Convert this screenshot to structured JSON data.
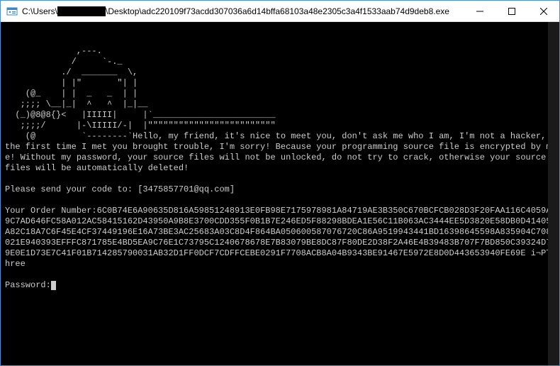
{
  "window": {
    "title_prefix": "C:\\Users\\",
    "title_redacted": "████████",
    "title_suffix": "\\Desktop\\adc220109f73acdd307036a6d14bffa68103a48e2305c3a4f1533aab74d9deb8.exe"
  },
  "console": {
    "ascii_art": "              ,---.\n             /     `-._\n           ./  _______  \\,\n           | |\"       \"| |\n    (@_    | |  _   _  | |\n   ;;;; \\__|_|  ^   ^  |_|__\n  (_)@8@8{}<   |IIIII|     |`________________________\n   ;;;;/      |-\\IIIII/-|  |\"\"\"\"\"\"\"\"\"\"\"\"\"\"\"\"\"\"\"\"\"\"\"\"\"\n    (@         `--------`",
    "greeting": "Hello, my friend, it's nice to meet you, don't ask me who I am, I'm not a hacker, the first time I met you brought trouble, I'm sorry! Because your programming source file is encrypted by me! Without my password, your source files will not be unlocked, do not try to crack, otherwise your source files will be automatically deleted!",
    "send_code_label": "Please send your code to: ",
    "send_code_email": "[3475857701@qq.com]",
    "order_label": "Your Order Number:",
    "order_number": "6C0B74E6A90635D816A59851248913E0FB98E7175978981A84719AE3B350C670BCFCB028D3F20FAA116C4059A9C7AD646FC58A012AC58415162D43950A9B8E3700CDD355F0B1B7E246ED5F88298BDEA1E56C11B063AC3444EE5D3820E58DB0D41405A82C18A7C6F45E4CF37449196E16A73BE3AC25683A03C8D4F864BA050600587076720C86A9519943441BD16398645598A835904C708021E940393EFFFC871785E4BD5EA9C76E1C73795C1240678678E7B83079BE8DC87F80DE2D38F2A46E4B39483B707F7BD850C39324D79E0E1D73E7C41F01B714285790031AB32D1FF0DCF7CDFFCEBE0291F7708ACB8A04B9343BE91467E5972E8D0D443653940FE69E i¬PThree",
    "password_label": "Password:"
  }
}
